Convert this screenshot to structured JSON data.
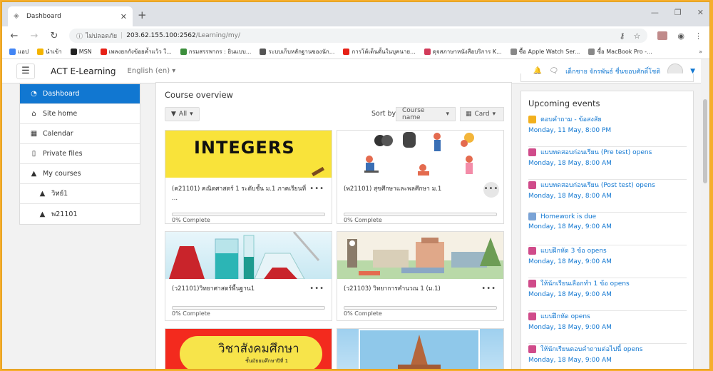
{
  "browser": {
    "tab_title": "Dashboard",
    "insecure_label": "ไม่ปลอดภัย",
    "url_host": "203.62.155.100:2562",
    "url_path": "/Learning/my/",
    "bookmarks": [
      {
        "label": "แอป",
        "color": "#4285f4"
      },
      {
        "label": "นำเข้า",
        "color": "#f4b400"
      },
      {
        "label": "MSN",
        "color": "#222222"
      },
      {
        "label": "เพลงยกกังข้อยค้ำแว้ว ใ...",
        "color": "#e62117"
      },
      {
        "label": "กรมสรรพากร : ยินแบบ...",
        "color": "#3c8e3c"
      },
      {
        "label": "ระบบเก็บหลักฐานของนัก...",
        "color": "#555555"
      },
      {
        "label": "การโต้เต็นดั้นในบุคนาย...",
        "color": "#e62117"
      },
      {
        "label": "ดุจสภาษาหนังสือบริการ K...",
        "color": "#d23b5a"
      },
      {
        "label": "ซื้อ Apple Watch Ser...",
        "color": "#888888"
      },
      {
        "label": "ซื้อ MacBook Pro -...",
        "color": "#888888"
      }
    ]
  },
  "navbar": {
    "brand": "ACT E-Learning",
    "language": "English (en)",
    "user_name": "เด็กชาย จักรพันธ์ ชื่นขอบศักดิ์โชติ"
  },
  "leftnav": [
    {
      "label": "Dashboard",
      "icon": "dashboard-icon",
      "active": true
    },
    {
      "label": "Site home",
      "icon": "home-icon"
    },
    {
      "label": "Calendar",
      "icon": "calendar-icon"
    },
    {
      "label": "Private files",
      "icon": "file-icon"
    },
    {
      "label": "My courses",
      "icon": "graduation-cap-icon"
    },
    {
      "label": "วิทย์1",
      "icon": "graduation-cap-icon",
      "sub": true
    },
    {
      "label": "พ21101",
      "icon": "graduation-cap-icon",
      "sub": true
    }
  ],
  "overview": {
    "title": "Course overview",
    "filter_label": "All",
    "sort_label": "Sort by",
    "sort_value": "Course name",
    "view_value": "Card",
    "integers_text": "INTEGERS",
    "social_text": "วิชาสังคมศึกษา",
    "social_sub": "ชั้นมัธยมศึกษาปีที่ 1",
    "courses": [
      {
        "name": "(ค21101) คณิตศาสตร์ 1 ระดับชั้น ม.1 ภาคเรียนที่ ...",
        "progress": 0,
        "progress_text": "0% Complete"
      },
      {
        "name": "(พ21101) สุขศึกษาและพลศึกษา ม.1",
        "progress": 0,
        "progress_text": "0% Complete"
      },
      {
        "name": "(ว21101)วิทยาศาสตร์พื้นฐาน1",
        "progress": 0,
        "progress_text": "0% Complete"
      },
      {
        "name": "(ว21103) วิทยาการคำนวณ 1 (ม.1)",
        "progress": 0,
        "progress_text": "0% Complete"
      }
    ]
  },
  "events": {
    "title": "Upcoming events",
    "items": [
      {
        "title": "ตอบคำถาม - ข้อสงสัย",
        "date": "Monday, 11 May, 8:00 PM",
        "color": "#f2b01e"
      },
      {
        "title": "แบบทดสอบก่อนเรียน (Pre test) opens",
        "date": "Monday, 18 May, 8:00 AM",
        "color": "#d04b8a"
      },
      {
        "title": "แบบทดสอบก่อนเรียน (Post test) opens",
        "date": "Monday, 18 May, 8:00 AM",
        "color": "#d04b8a"
      },
      {
        "title": "Homework is due",
        "date": "Monday, 18 May, 9:00 AM",
        "color": "#7aa3d6"
      },
      {
        "title": "แบบฝึกหัด 3 ข้อ opens",
        "date": "Monday, 18 May, 9:00 AM",
        "color": "#d04b8a"
      },
      {
        "title": "ให้นักเรียนเลือกทำ 1 ข้อ opens",
        "date": "Monday, 18 May, 9:00 AM",
        "color": "#d04b8a"
      },
      {
        "title": "แบบฝึกหัด opens",
        "date": "Monday, 18 May, 9:00 AM",
        "color": "#d04b8a"
      },
      {
        "title": "ให้นักเรียนตอบคำถามต่อไปนี้ opens",
        "date": "Monday, 18 May, 9:00 AM",
        "color": "#d04b8a"
      }
    ]
  }
}
